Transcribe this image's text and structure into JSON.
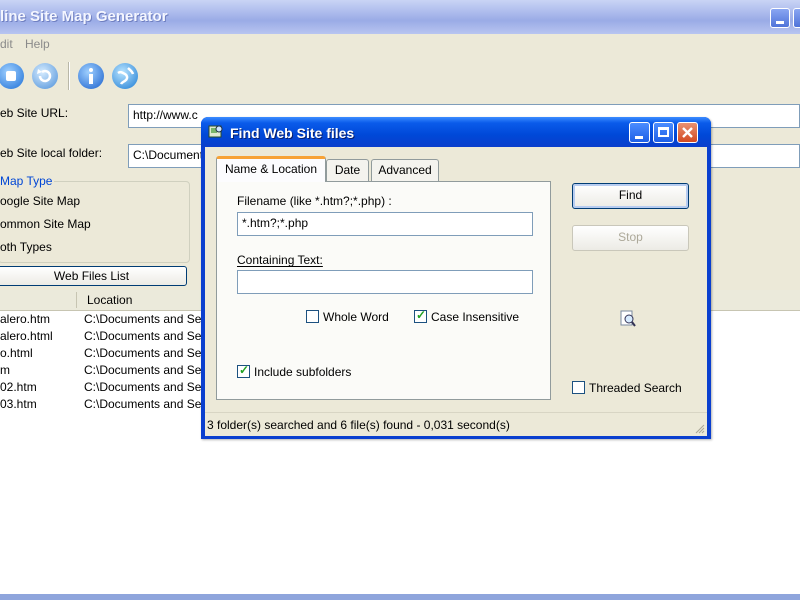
{
  "main_window": {
    "title": "line Site Map Generator",
    "menu": [
      "dit",
      "Help"
    ],
    "labels": {
      "url": "eb Site URL:",
      "folder": "eb Site local folder:",
      "map_type": "Map Type"
    },
    "url_value": "http://www.c",
    "folder_value": "C:\\Document",
    "map_type_options": [
      "oogle Site Map",
      "ommon Site Map",
      "oth Types"
    ],
    "web_files_button": "Web Files List",
    "list": {
      "columns": [
        "",
        "Location"
      ],
      "rows": [
        {
          "name": "alero.htm",
          "location": "C:\\Documents and Se"
        },
        {
          "name": "alero.html",
          "location": "C:\\Documents and Se"
        },
        {
          "name": "o.html",
          "location": "C:\\Documents and Se"
        },
        {
          "name": "m",
          "location": "C:\\Documents and Se"
        },
        {
          "name": "02.htm",
          "location": "C:\\Documents and Se"
        },
        {
          "name": "03.htm",
          "location": "C:\\Documents and Se"
        }
      ]
    }
  },
  "dialog": {
    "title": "Find Web Site files",
    "tabs": [
      "Name & Location",
      "Date",
      "Advanced"
    ],
    "filename_label": "Filename (like *.htm?;*.php) :",
    "filename_value": "*.htm?;*.php",
    "containing_label": "Containing Text:",
    "containing_value": "",
    "whole_word": {
      "label": "Whole Word",
      "checked": false
    },
    "case_insensitive": {
      "label": "Case Insensitive",
      "checked": true
    },
    "include_subfolders": {
      "label": "Include subfolders",
      "checked": true
    },
    "threaded_search": {
      "label": "Threaded Search",
      "checked": false
    },
    "find_button": "Find",
    "stop_button": "Stop",
    "status": "3 folder(s) searched and 6 file(s) found - 0,031 second(s)"
  },
  "colors": {
    "xp_blue": "#0a4ad8",
    "xp_face": "#ece9d8",
    "check_green": "#21a121",
    "tab_accent": "#f7a236"
  }
}
